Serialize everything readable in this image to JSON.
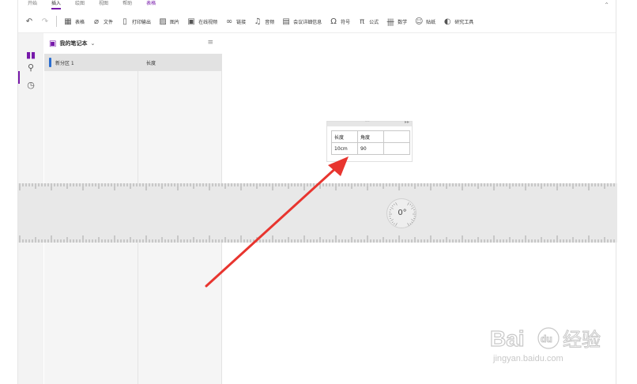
{
  "ribbon": {
    "tabs": [
      "开始",
      "插入",
      "绘图",
      "视图",
      "帮助",
      "表格"
    ],
    "active_tab": "插入",
    "corner_icon": "collapse-ribbon-icon"
  },
  "toolbar": {
    "undo_icon": "undo-icon",
    "redo_icon": "redo-icon",
    "buttons": [
      {
        "icon": "table-icon",
        "glyph": "▦",
        "label": "表格"
      },
      {
        "icon": "attach-file-icon",
        "glyph": "⌀",
        "label": "文件"
      },
      {
        "icon": "printout-icon",
        "glyph": "▯",
        "label": "打印输出"
      },
      {
        "icon": "picture-icon",
        "glyph": "▨",
        "label": "图片"
      },
      {
        "icon": "online-video-icon",
        "glyph": "▣",
        "label": "在线视频"
      },
      {
        "icon": "link-icon",
        "glyph": "∞",
        "label": "链接"
      },
      {
        "icon": "audio-icon",
        "glyph": "♫",
        "label": "音频"
      },
      {
        "icon": "meeting-details-icon",
        "glyph": "▤",
        "label": "会议详细信息"
      },
      {
        "icon": "symbol-icon",
        "glyph": "Ω",
        "label": "符号"
      },
      {
        "icon": "equation-icon",
        "glyph": "π",
        "label": "公式"
      },
      {
        "icon": "math-icon",
        "glyph": "卌",
        "label": "数学"
      },
      {
        "icon": "sticker-icon",
        "glyph": "☺",
        "label": "贴纸"
      },
      {
        "icon": "researcher-icon",
        "glyph": "◐",
        "label": "研究工具"
      }
    ]
  },
  "rail": {
    "items": [
      "notebooks-icon",
      "search-icon",
      "recent-icon"
    ]
  },
  "notebook": {
    "name": "我的笔记本",
    "chevron": "⌄",
    "sort_icon": "sort-icon"
  },
  "sections": [
    {
      "label": "新分区 1",
      "color": "#2a6dcf"
    }
  ],
  "pages": [
    {
      "label": "长度"
    }
  ],
  "note_table": {
    "rows": [
      [
        "长度",
        "角度",
        ""
      ],
      [
        "10cm",
        "90",
        ""
      ]
    ]
  },
  "ruler": {
    "protractor_readout": "0°"
  },
  "annotation": {
    "arrow_color": "#e8352f"
  },
  "watermark": {
    "url": "jingyan.baidu.com"
  }
}
